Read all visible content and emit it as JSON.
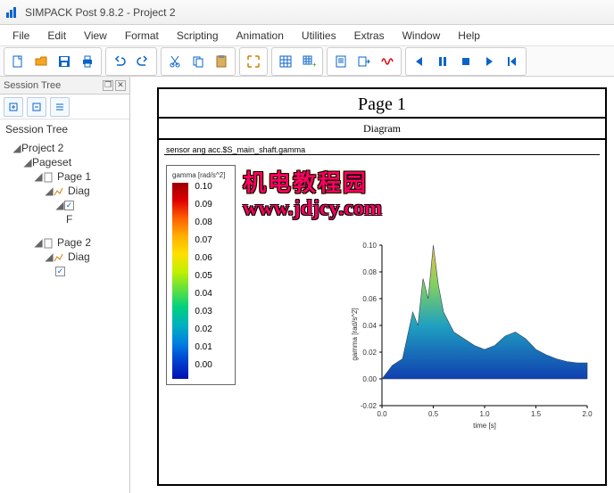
{
  "window": {
    "title": "SIMPACK Post 9.8.2 - Project 2"
  },
  "menu": [
    "File",
    "Edit",
    "View",
    "Format",
    "Scripting",
    "Animation",
    "Utilities",
    "Extras",
    "Window",
    "Help"
  ],
  "session_tree": {
    "panel_label": "Session Tree",
    "title": "Session Tree",
    "root": "Project 2",
    "pageset": "Pageset",
    "page1": "Page 1",
    "diag1": "Diag",
    "f_item": "F",
    "page2": "Page 2",
    "diag2": "Diag"
  },
  "page": {
    "title": "Page 1",
    "subtitle": "Diagram",
    "sensor": "sensor ang acc.$S_main_shaft.gamma"
  },
  "legend": {
    "label": "gamma [rad/s^2]",
    "ticks": [
      "0.10",
      "0.09",
      "0.08",
      "0.07",
      "0.06",
      "0.05",
      "0.04",
      "0.03",
      "0.02",
      "0.01",
      "0.00"
    ]
  },
  "watermark": {
    "line1": "机电教程园",
    "line2": "www.jdjcy.com"
  },
  "chart_data": {
    "type": "area",
    "xlabel": "time [s]",
    "ylabel": "gamma [rad/s^2]",
    "xlim": [
      0.0,
      2.0
    ],
    "ylim": [
      -0.02,
      0.1
    ],
    "xticks": [
      0.0,
      0.5,
      1.0,
      1.5,
      2.0
    ],
    "yticks": [
      -0.02,
      0.0,
      0.02,
      0.04,
      0.06,
      0.08,
      0.1
    ],
    "x": [
      0.0,
      0.1,
      0.2,
      0.3,
      0.35,
      0.4,
      0.45,
      0.5,
      0.55,
      0.6,
      0.7,
      0.8,
      0.9,
      1.0,
      1.1,
      1.2,
      1.3,
      1.4,
      1.5,
      1.6,
      1.7,
      1.8,
      1.9,
      2.0
    ],
    "values": [
      0.0,
      0.01,
      0.015,
      0.05,
      0.04,
      0.075,
      0.06,
      0.1,
      0.07,
      0.05,
      0.035,
      0.03,
      0.025,
      0.022,
      0.025,
      0.032,
      0.035,
      0.03,
      0.022,
      0.018,
      0.015,
      0.013,
      0.012,
      0.012
    ],
    "colormap_label": "gamma [rad/s^2]"
  }
}
